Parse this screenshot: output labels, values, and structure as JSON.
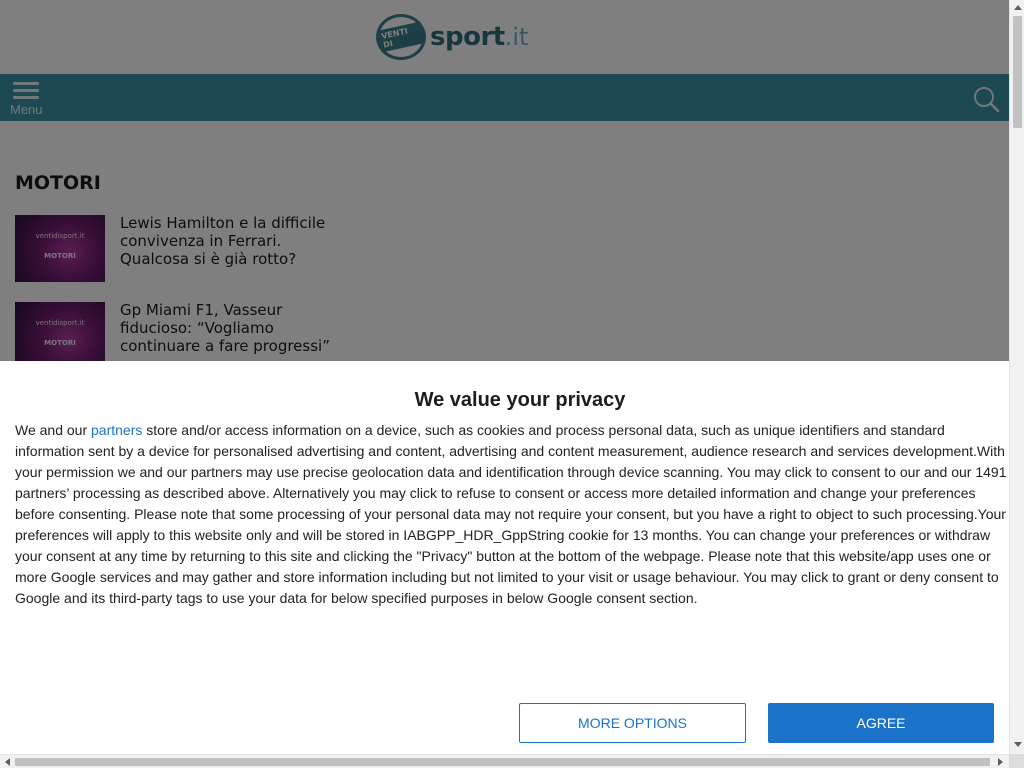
{
  "site": {
    "logo_badge": "VENTI DI",
    "logo_word": "sport",
    "logo_tld": ".it"
  },
  "nav": {
    "menu_label": "Menu",
    "menu_icon": "hamburger-icon",
    "search_icon": "search-icon",
    "bar_color": "#3a93a7"
  },
  "section": {
    "title": "MOTORI",
    "articles": [
      {
        "thumb_site": "ventidisport.it",
        "thumb_category": "MOTORI",
        "title": "Lewis Hamilton e la difficile convivenza in Ferrari. Qualcosa si è già rotto?"
      },
      {
        "thumb_site": "ventidisport.it",
        "thumb_category": "MOTORI",
        "title": "Gp Miami F1, Vasseur fiducioso: “Vogliamo continuare a fare progressi”"
      }
    ]
  },
  "consent": {
    "title": "We value your privacy",
    "body_pre": "We and our ",
    "partners_link": "partners",
    "body_post": " store and/or access information on a device, such as cookies and process personal data, such as unique identifiers and standard information sent by a device for personalised advertising and content, advertising and content measurement, audience research and services development.With your permission we and our partners may use precise geolocation data and identification through device scanning. You may click to consent to our and our 1491 partners’ processing as described above. Alternatively you may click to refuse to consent or access more detailed information and change your preferences before consenting. Please note that some processing of your personal data may not require your consent, but you have a right to object to such processing.Your preferences will apply to this website only and will be stored in IABGPP_HDR_GppString cookie for 13 months. You can change your preferences or withdraw your consent at any time by returning to this site and clicking the \"Privacy\" button at the bottom of the webpage. Please note that this website/app uses one or more Google services and may gather and store information including but not limited to your visit or usage behaviour. You may click to grant or deny consent to Google and its third-party tags to use your data for below specified purposes in below Google consent section.",
    "more_options_label": "MORE OPTIONS",
    "agree_label": "AGREE",
    "accent_color": "#1a73c8"
  }
}
